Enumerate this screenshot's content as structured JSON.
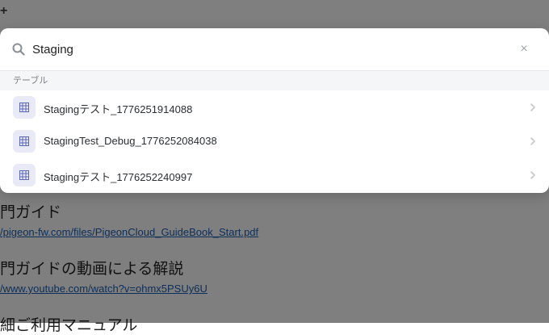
{
  "background": {
    "plus_symbol": "+",
    "sections": [
      {
        "heading": "門ガイド",
        "link": "/pigeon-fw.com/files/PigeonCloud_GuideBook_Start.pdf"
      },
      {
        "heading": "門ガイドの動画による解説",
        "link": "/www.youtube.com/watch?v=ohmx5PSUy6U"
      },
      {
        "heading": "細ご利用マニュアル"
      }
    ]
  },
  "search": {
    "value": "Staging",
    "clear_symbol": "×",
    "icon": "search-icon"
  },
  "results": {
    "section_label": "テーブル",
    "items": [
      {
        "label": "Stagingテスト_1776251914088",
        "icon": "table-icon"
      },
      {
        "label": "StagingTest_Debug_1776252084038",
        "icon": "table-icon"
      },
      {
        "label": "Stagingテスト_1776252240997",
        "icon": "table-icon"
      }
    ]
  },
  "colors": {
    "overlay": "rgba(0,0,0,0.5)",
    "icon_bg": "#e8ebf7",
    "icon_fg": "#5a66b8",
    "link": "#1a5fb4"
  }
}
